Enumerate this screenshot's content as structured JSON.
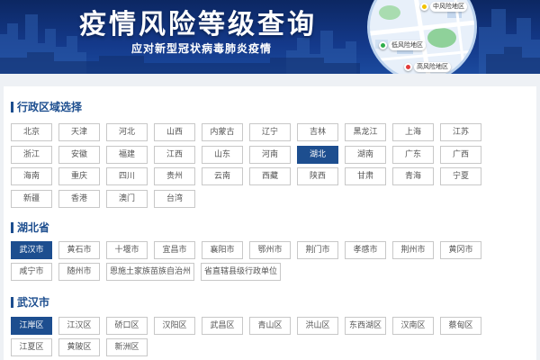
{
  "header": {
    "title": "疫情风险等级查询",
    "subtitle": "应对新型冠状病毒肺炎疫情",
    "map_legend": {
      "medium": "中风险地区",
      "low": "低风险地区",
      "high": "高风险地区"
    }
  },
  "colors": {
    "primary": "#1d4e8f",
    "medium_risk": "#f2c200",
    "low_risk": "#2fae4a",
    "high_risk": "#e23b3b"
  },
  "region_selector": {
    "title": "行政区域选择",
    "selected": [
      1,
      6
    ],
    "rows": [
      [
        "北京",
        "天津",
        "河北",
        "山西",
        "内蒙古",
        "辽宁",
        "吉林",
        "黑龙江",
        "上海",
        "江苏"
      ],
      [
        "浙江",
        "安徽",
        "福建",
        "江西",
        "山东",
        "河南",
        "湖北",
        "湖南",
        "广东",
        "广西"
      ],
      [
        "海南",
        "重庆",
        "四川",
        "贵州",
        "云南",
        "西藏",
        "陕西",
        "甘肃",
        "青海",
        "宁夏"
      ],
      [
        "新疆",
        "香港",
        "澳门",
        "台湾"
      ]
    ]
  },
  "province": {
    "title": "湖北省",
    "selected": [
      0,
      0
    ],
    "rows": [
      [
        "武汉市",
        "黄石市",
        "十堰市",
        "宜昌市",
        "襄阳市",
        "鄂州市",
        "荆门市",
        "孝感市",
        "荆州市",
        "黄冈市"
      ],
      [
        "咸宁市",
        "随州市",
        "恩施土家族苗族自治州",
        "省直辖县级行政单位"
      ]
    ]
  },
  "city": {
    "title": "武汉市",
    "selected": [
      0,
      0
    ],
    "rows": [
      [
        "江岸区",
        "江汉区",
        "硚口区",
        "汉阳区",
        "武昌区",
        "青山区",
        "洪山区",
        "东西湖区",
        "汉南区",
        "蔡甸区"
      ],
      [
        "江夏区",
        "黄陂区",
        "新洲区"
      ]
    ]
  }
}
